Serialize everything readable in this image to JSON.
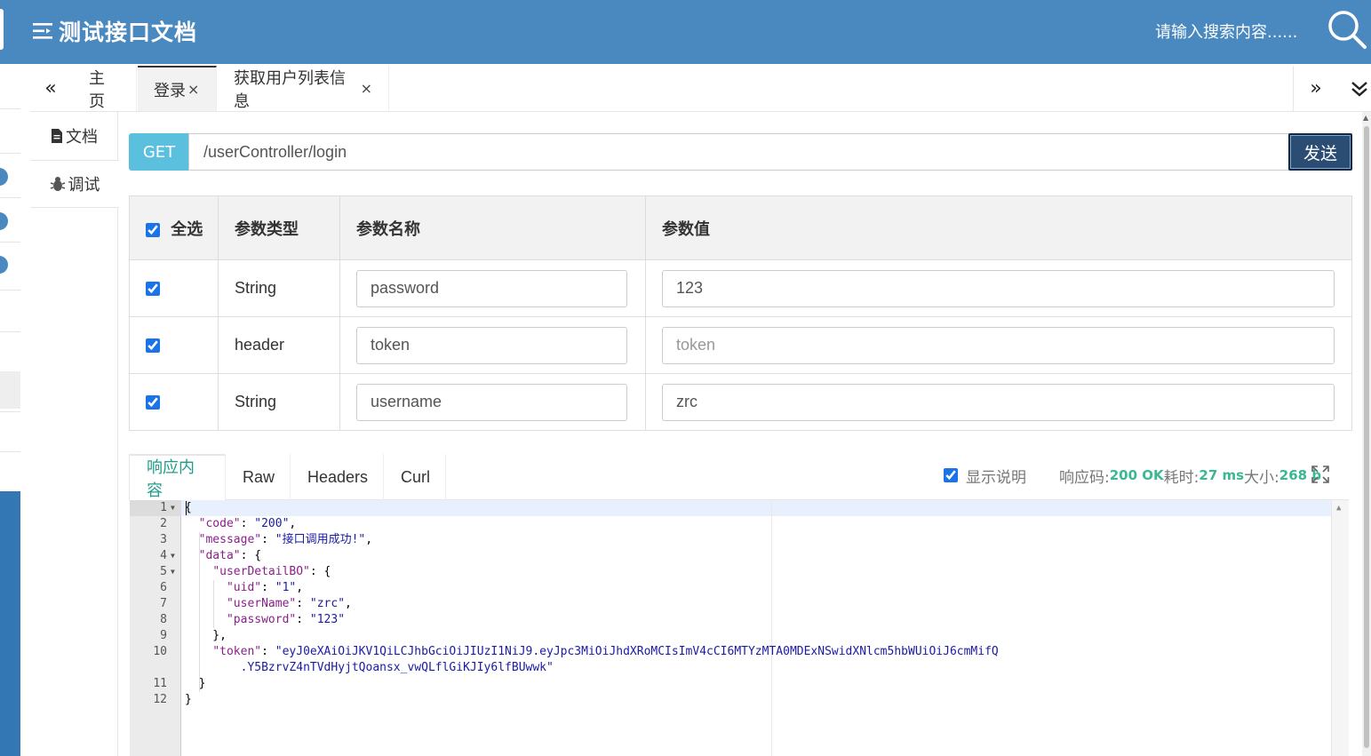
{
  "header": {
    "title": "测试接口文档",
    "search_placeholder": "请输入搜索内容......"
  },
  "tabs": [
    {
      "label": "主页",
      "closable": false
    },
    {
      "label": "登录",
      "closable": true,
      "active": true
    },
    {
      "label": "获取用户列表信息",
      "closable": true
    }
  ],
  "tab_close_symbol": "×",
  "nav": {
    "prev": "«",
    "next": "»"
  },
  "side_tabs": {
    "doc": "文档",
    "debug": "调试"
  },
  "request": {
    "method": "GET",
    "url": "/userController/login",
    "send_label": "发送"
  },
  "params_table": {
    "headers": {
      "select_all": "全选",
      "type": "参数类型",
      "name": "参数名称",
      "value": "参数值"
    },
    "rows": [
      {
        "checked": true,
        "type": "String",
        "name": "password",
        "value": "123",
        "value_placeholder": ""
      },
      {
        "checked": true,
        "type": "header",
        "name": "token",
        "value": "",
        "value_placeholder": "token"
      },
      {
        "checked": true,
        "type": "String",
        "name": "username",
        "value": "zrc",
        "value_placeholder": ""
      }
    ]
  },
  "response": {
    "tabs": [
      "响应内容",
      "Raw",
      "Headers",
      "Curl"
    ],
    "show_desc_label": "显示说明",
    "status_label": "响应码:",
    "status_value": "200 OK",
    "time_label": "耗时:",
    "time_value": "27 ms",
    "size_label": "大小:",
    "size_value": "268 b",
    "line_numbers": [
      "1",
      "2",
      "3",
      "4",
      "5",
      "6",
      "7",
      "8",
      "9",
      "10",
      "",
      "11",
      "12"
    ],
    "body": {
      "brace_open": "{",
      "code_key": "\"code\"",
      "code_val": "\"200\"",
      "message_key": "\"message\"",
      "message_val": "\"接口调用成功!\"",
      "data_key": "\"data\"",
      "userDetailBO_key": "\"userDetailBO\"",
      "uid_key": "\"uid\"",
      "uid_val": "\"1\"",
      "userName_key": "\"userName\"",
      "userName_val": "\"zrc\"",
      "password_key": "\"password\"",
      "password_val": "\"123\"",
      "token_key": "\"token\"",
      "token_val_1": "\"eyJ0eXAiOiJKV1QiLCJhbGciOiJIUzI1NiJ9.eyJpc3MiOiJhdXRoMCIsImV4cCI6MTYzMTA0MDExNSwidXNlcm5hbWUiOiJ6cmMifQ",
      "token_val_2": ".Y5BzrvZ4nTVdHyjtQoansx_vwQLflGiKJIy6lfBUwwk\""
    }
  },
  "colors": {
    "header_bg": "#4a89c0",
    "method_bg": "#5bc0de",
    "send_bg": "#2b4d73",
    "active_tab_text": "#1e9e8a",
    "status_green": "#3bb893"
  }
}
